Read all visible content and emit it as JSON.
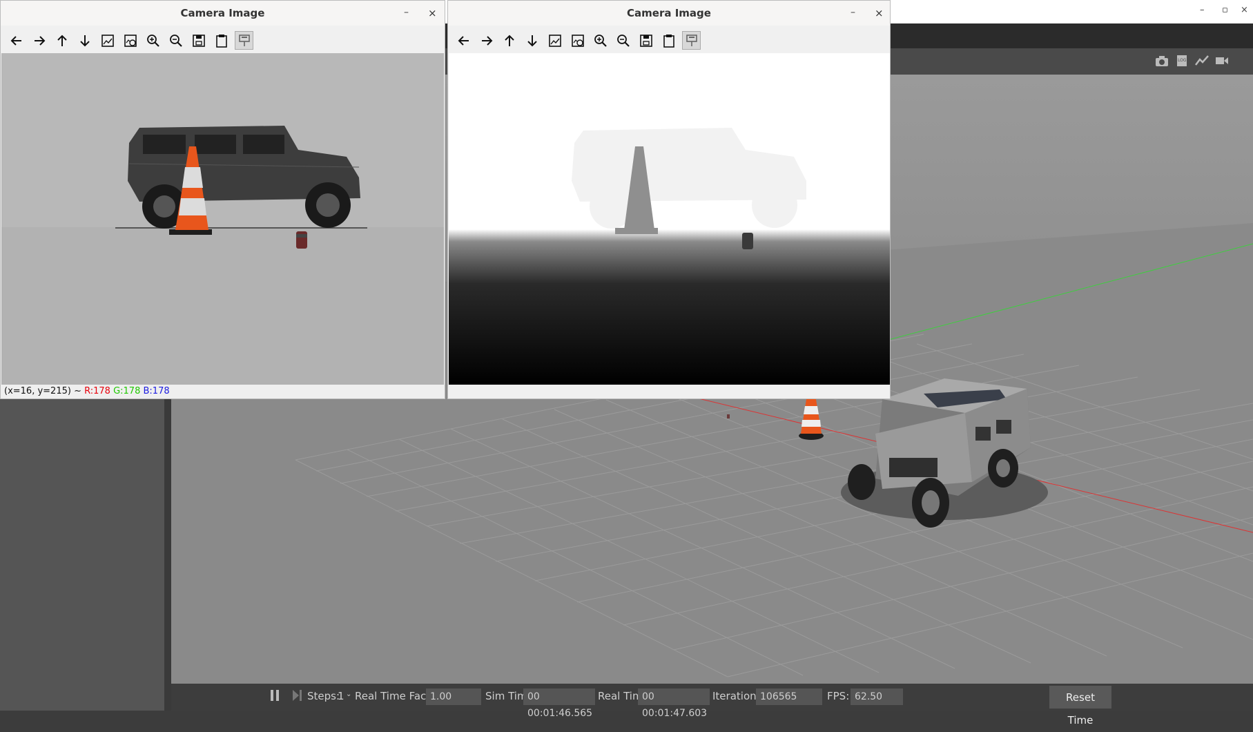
{
  "camera_windows": [
    {
      "title": "Camera Image",
      "status": {
        "coords": "(x=16, y=215) ~",
        "r": "R:178",
        "g": "G:178",
        "b": "B:178"
      }
    },
    {
      "title": "Camera Image",
      "status": null
    }
  ],
  "toolbar_icons": [
    "back-icon",
    "forward-icon",
    "up-icon",
    "down-icon",
    "image-icon",
    "image-settings-icon",
    "zoom-in-icon",
    "zoom-out-icon",
    "save-icon",
    "clipboard-icon",
    "pin-icon"
  ],
  "window_controls": {
    "minimize": "–",
    "close": "×",
    "restore": "▫"
  },
  "gazebo": {
    "toolbar_icons": [
      "camera-icon",
      "log-icon",
      "plot-icon",
      "video-icon"
    ],
    "bottom_bar": {
      "steps_label": "Steps:",
      "steps_value": "1",
      "rtf_label": "Real Time Factor:",
      "rtf_value": "1.00",
      "sim_time_label": "Sim Time:",
      "sim_time_value": "00 00:01:46.565",
      "real_time_label": "Real Time:",
      "real_time_value": "00 00:01:47.603",
      "iterations_label": "Iterations:",
      "iterations_value": "106565",
      "fps_label": "FPS:",
      "fps_value": "62.50",
      "reset_label": "Reset Time"
    }
  },
  "colors": {
    "status_r": "#e8000b",
    "status_g": "#1fc800",
    "status_b": "#1a1ae0",
    "cone_orange": "#e8561c"
  }
}
